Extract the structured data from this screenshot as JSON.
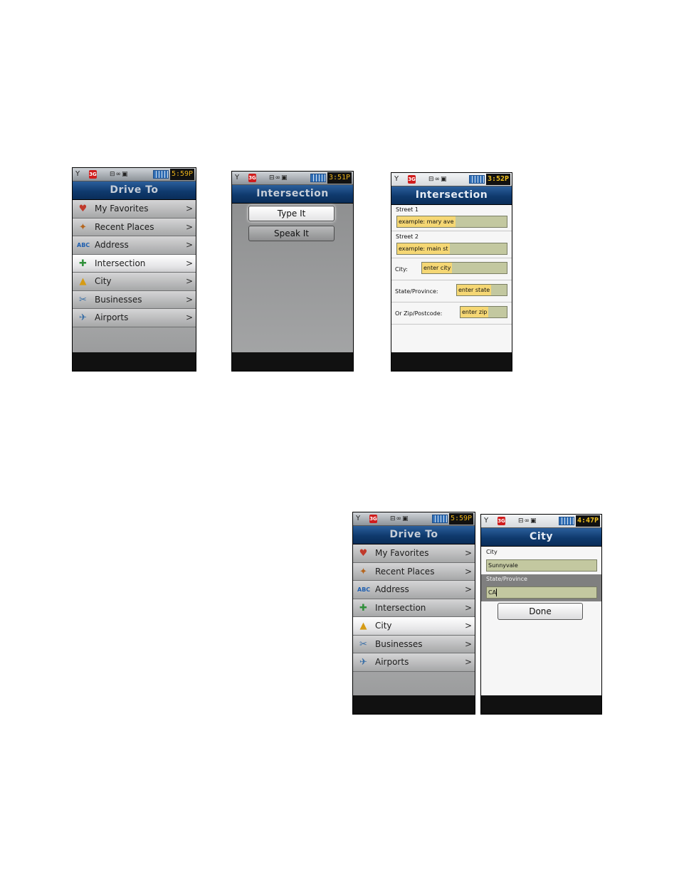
{
  "status": {
    "signal": "Y",
    "network": "3G",
    "misc": "⊟∞▣"
  },
  "screen1": {
    "time": "5:59P",
    "title": "Drive To",
    "items": [
      {
        "label": "My Favorites",
        "icon": "favorites-icon",
        "glyph": "♥"
      },
      {
        "label": "Recent Places",
        "icon": "recent-places-icon",
        "glyph": "✦"
      },
      {
        "label": "Address",
        "icon": "address-icon",
        "glyph": "ᴬᴮᶜ"
      },
      {
        "label": "Intersection",
        "icon": "intersection-icon",
        "glyph": "✚"
      },
      {
        "label": "City",
        "icon": "city-icon",
        "glyph": "▲"
      },
      {
        "label": "Businesses",
        "icon": "businesses-icon",
        "glyph": "✂"
      },
      {
        "label": "Airports",
        "icon": "airports-icon",
        "glyph": "✈"
      }
    ],
    "selected": "Intersection"
  },
  "screen2": {
    "time": "3:51P",
    "title": "Intersection",
    "type_label": "Type It",
    "speak_label": "Speak It"
  },
  "screen3": {
    "time": "3:52P",
    "title": "Intersection",
    "street1_label": "Street 1",
    "street1_placeholder": "example: mary ave",
    "street2_label": "Street 2",
    "street2_placeholder": "example: main st",
    "city_label": "City:",
    "city_placeholder": "enter city",
    "state_label": "State/Province:",
    "state_placeholder": "enter state",
    "zip_label": "Or Zip/Postcode:",
    "zip_placeholder": "enter zip"
  },
  "screen4": {
    "time": "5:59P",
    "title": "Drive To",
    "items": [
      {
        "label": "My Favorites"
      },
      {
        "label": "Recent Places"
      },
      {
        "label": "Address"
      },
      {
        "label": "Intersection"
      },
      {
        "label": "City"
      },
      {
        "label": "Businesses"
      },
      {
        "label": "Airports"
      }
    ],
    "selected": "City"
  },
  "screen5": {
    "time": "4:47P",
    "title": "City",
    "city_label": "City",
    "city_value": "Sunnyvale",
    "state_label": "State/Province",
    "state_value": "CA",
    "done_label": "Done"
  },
  "colors": {
    "title_bar": "#0f3a6e",
    "hint_yellow": "#f5d774",
    "input_fill": "#c3c8a0",
    "clock_text": "#f2c21e"
  }
}
